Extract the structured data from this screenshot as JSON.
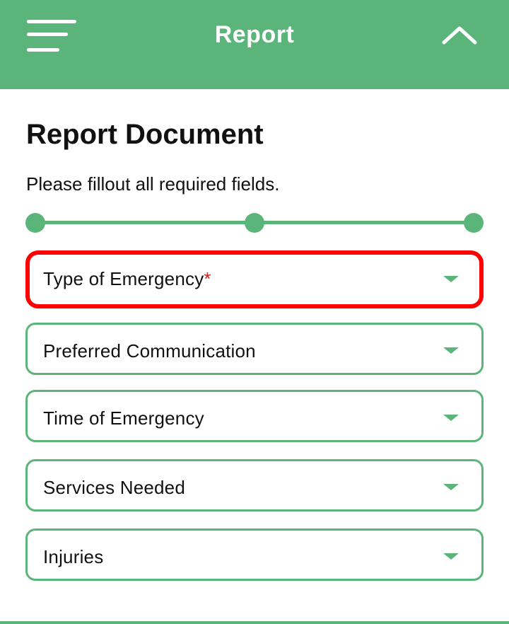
{
  "header": {
    "title": "Report",
    "menu_icon": "hamburger-menu-icon",
    "collapse_icon": "chevron-up-icon",
    "background_color": "#5bb57a"
  },
  "page": {
    "title": "Report Document",
    "subtitle": "Please fillout all required fields."
  },
  "stepper": {
    "steps": 3,
    "color": "#5bb57a"
  },
  "fields": [
    {
      "label": "Type of Emergency",
      "required_mark": "*",
      "state": "highlighted-error",
      "caret_icon": "caret-down-icon"
    },
    {
      "label": "Preferred Communication",
      "caret_icon": "caret-down-icon"
    },
    {
      "label": "Time of Emergency",
      "caret_icon": "caret-down-icon"
    },
    {
      "label": "Services Needed",
      "caret_icon": "caret-down-icon"
    },
    {
      "label": "Injuries",
      "caret_icon": "caret-down-icon"
    }
  ],
  "colors": {
    "accent": "#5bb57a",
    "error_border": "#ff0000",
    "required_asterisk": "#d32020"
  }
}
